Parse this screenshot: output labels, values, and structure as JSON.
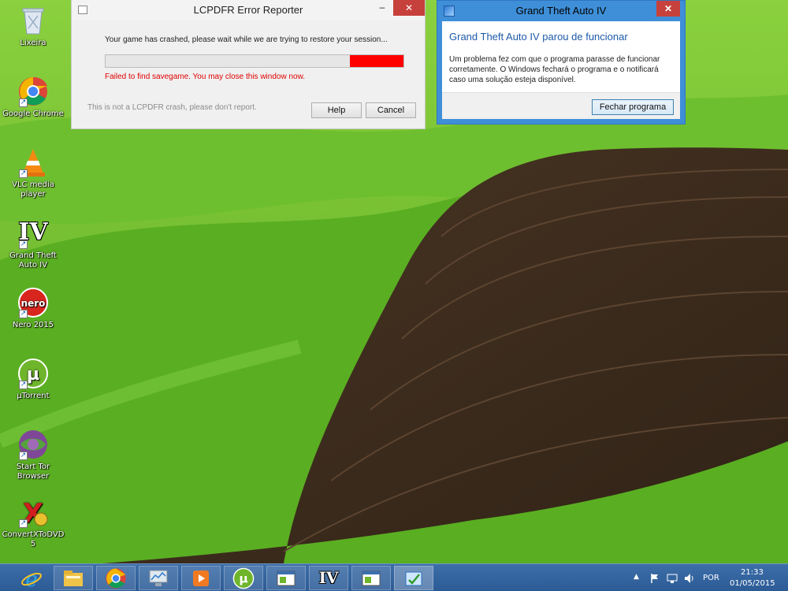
{
  "desktop_icons": [
    {
      "label": "Lixeira",
      "icon": "recycle-bin-icon"
    },
    {
      "label": "Google Chrome",
      "icon": "chrome-icon"
    },
    {
      "label": "VLC media player",
      "icon": "vlc-icon"
    },
    {
      "label": "Grand Theft Auto IV",
      "icon": "gta-iv-icon",
      "glyph": "IV"
    },
    {
      "label": "Nero 2015",
      "icon": "nero-icon",
      "glyph": "nero"
    },
    {
      "label": "µTorrent",
      "icon": "utorrent-icon",
      "glyph": "µ"
    },
    {
      "label": "Start Tor Browser",
      "icon": "tor-browser-icon"
    },
    {
      "label": "ConvertXToDVD 5",
      "icon": "convertxtodvd-icon",
      "glyph": "X"
    }
  ],
  "lcpdfr": {
    "title": "LCPDFR Error Reporter",
    "message": "Your game has crashed, please wait while we are trying to restore your session...",
    "progress": 0.82,
    "error": "Failed to find savegame. You may close this window now.",
    "note": "This is not a LCPDFR crash, please don't report.",
    "help_label": "Help",
    "cancel_label": "Cancel",
    "minimize": "–",
    "maximize": "□",
    "close": "✕"
  },
  "gta_dialog": {
    "title": "Grand Theft Auto IV",
    "heading": "Grand Theft Auto IV parou de funcionar",
    "body": "Um problema fez com que o programa parasse de funcionar corretamente. O Windows fechará o programa e o notificará caso uma solução esteja disponível.",
    "button": "Fechar programa",
    "close": "✕"
  },
  "taskbar": {
    "items": [
      {
        "name": "ie-icon"
      },
      {
        "name": "file-explorer-icon"
      },
      {
        "name": "chrome-icon"
      },
      {
        "name": "network-monitor-icon"
      },
      {
        "name": "media-player-icon"
      },
      {
        "name": "utorrent-icon",
        "glyph": "µ"
      },
      {
        "name": "app-window-icon"
      },
      {
        "name": "gta-iv-icon",
        "glyph": "IV"
      },
      {
        "name": "app-window-icon"
      },
      {
        "name": "error-reporter-icon"
      }
    ],
    "language": "POR",
    "time": "21:33",
    "date": "01/05/2015",
    "colors": {
      "taskbar": "#2c5b96",
      "close": "#c7413c",
      "progress": "#ff0000",
      "error_text": "#e00000",
      "heading": "#1e5aa8"
    }
  }
}
